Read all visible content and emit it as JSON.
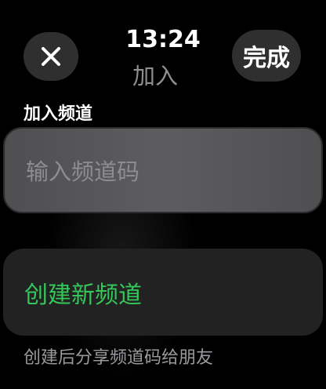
{
  "header": {
    "time": "13:24",
    "subtitle": "加入",
    "close_icon": "close-icon",
    "done_label": "完成"
  },
  "join_channel": {
    "section_label": "加入频道",
    "input_placeholder": "输入频道码",
    "input_value": ""
  },
  "create_channel": {
    "button_label": "创建新频道",
    "footnote": "创建后分享频道码给朋友"
  },
  "colors": {
    "accent_green": "#34c759",
    "button_bg": "#2f2f2f",
    "secondary_text": "#8e8e93"
  }
}
